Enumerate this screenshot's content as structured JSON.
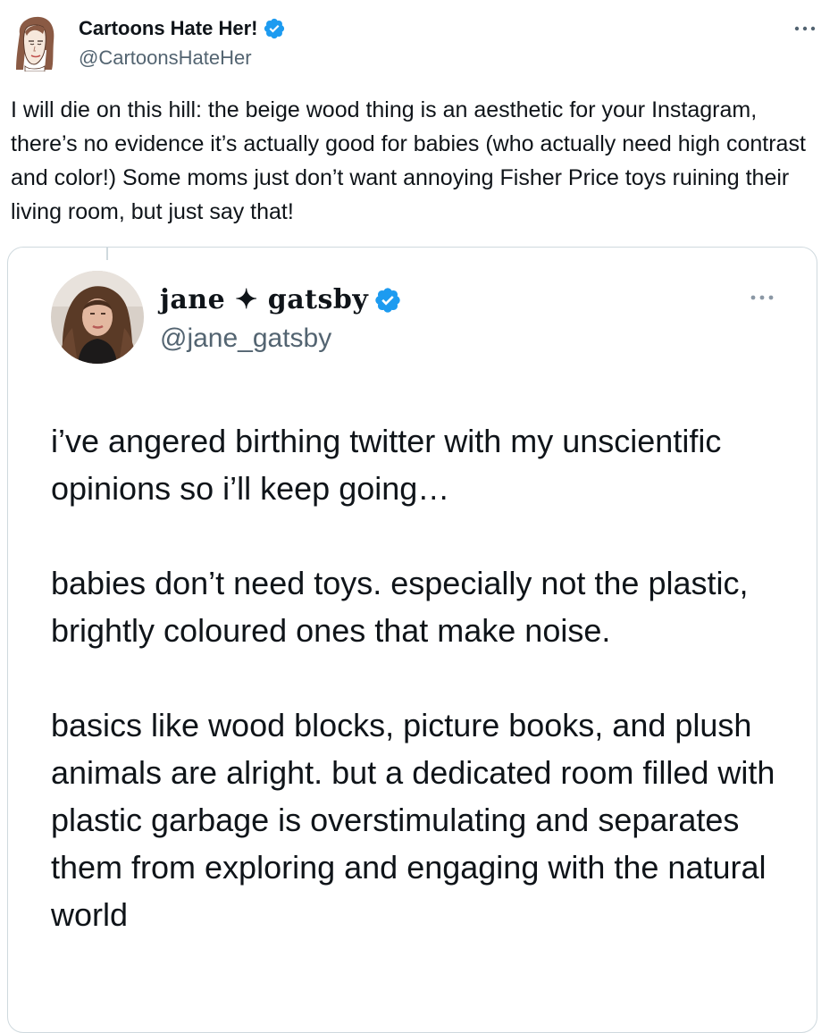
{
  "tweet": {
    "author": {
      "name": "Cartoons Hate Her!",
      "handle": "@CartoonsHateHer",
      "verified": true,
      "avatar_icon": "illustrated-woman-avatar"
    },
    "text": "I will die on this hill: the beige wood thing is an aesthetic for your Instagram, there’s no evidence it’s actually good for babies (who actually need high contrast and color!) Some moms just don’t want annoying Fisher Price toys ruining their living room, but just say that!"
  },
  "quoted_tweet": {
    "author": {
      "name": "jane ✦ gatsby",
      "handle": "@jane_gatsby",
      "verified": true,
      "avatar_icon": "profile-photo-avatar"
    },
    "paragraphs": [
      "i’ve angered birthing twitter with my unscientific opinions so i’ll keep going…",
      "babies don’t need toys. especially not the plastic, brightly coloured ones that make noise.",
      "basics like wood blocks, picture books, and plush animals are alright. but a dedicated room filled with plastic garbage is overstimulating and separates them from exploring and engaging with the natural world"
    ]
  },
  "colors": {
    "text": "#0f1419",
    "secondary_text": "#536471",
    "verified_blue": "#1d9bf0",
    "border": "#cfd9de"
  }
}
